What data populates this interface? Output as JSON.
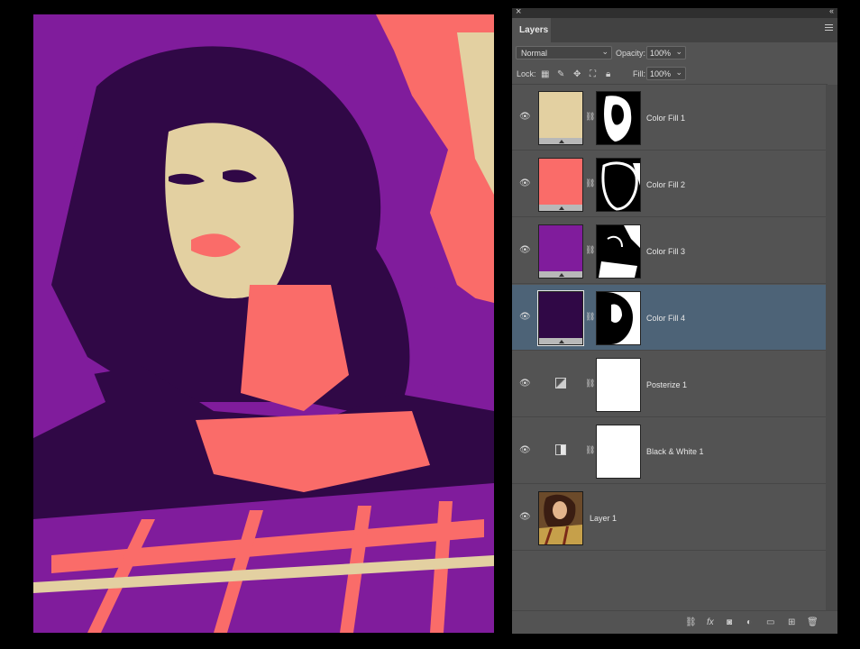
{
  "panel": {
    "close_glyph": "×",
    "collapse_glyph": "‹‹",
    "tab_label": "Layers",
    "blend_mode": "Normal",
    "opacity_label": "Opacity:",
    "opacity_value": "100%",
    "lock_label": "Lock:",
    "fill_label": "Fill:",
    "fill_value": "100%"
  },
  "colors": {
    "accent_selected": "#4d6377",
    "fill1": "#e3d0a1",
    "fill2": "#fa6c69",
    "fill3": "#801c9c",
    "fill4": "#300846"
  },
  "layers": [
    {
      "name": "Color Fill 1",
      "type": "color-fill",
      "color": "#e3d0a1",
      "selected": false
    },
    {
      "name": "Color Fill 2",
      "type": "color-fill",
      "color": "#fa6c69",
      "selected": false
    },
    {
      "name": "Color Fill 3",
      "type": "color-fill",
      "color": "#801c9c",
      "selected": false
    },
    {
      "name": "Color Fill 4",
      "type": "color-fill",
      "color": "#300846",
      "selected": true
    },
    {
      "name": "Posterize 1",
      "type": "adjustment",
      "icon": "posterize-icon",
      "selected": false
    },
    {
      "name": "Black & White 1",
      "type": "adjustment",
      "icon": "black-white-icon",
      "selected": false
    },
    {
      "name": "Layer 1",
      "type": "pixel",
      "selected": false
    }
  ],
  "bottom_icons": [
    "link-layers-icon",
    "fx-icon",
    "add-mask-icon",
    "adjustment-layer-icon",
    "new-group-icon",
    "new-layer-icon",
    "trash-icon"
  ],
  "bottom_glyphs": {
    "fx": "fx"
  }
}
